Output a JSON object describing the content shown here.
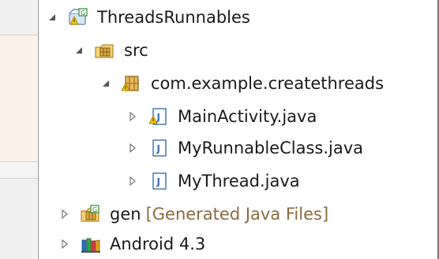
{
  "tree": {
    "project": {
      "label": "ThreadsRunnables"
    },
    "src": {
      "label": "src"
    },
    "package": {
      "label": "com.example.createthreads"
    },
    "files": [
      {
        "label": "MainActivity.java"
      },
      {
        "label": "MyRunnableClass.java"
      },
      {
        "label": "MyThread.java"
      }
    ],
    "gen": {
      "label": "gen",
      "sublabel": "[Generated Java Files]"
    },
    "android": {
      "label": "Android 4.3"
    }
  },
  "colors": {
    "arrow": "#e02020",
    "package_icon": "#c8a040",
    "java_icon_border": "#3b6fb6",
    "warning": "#f2c200"
  }
}
